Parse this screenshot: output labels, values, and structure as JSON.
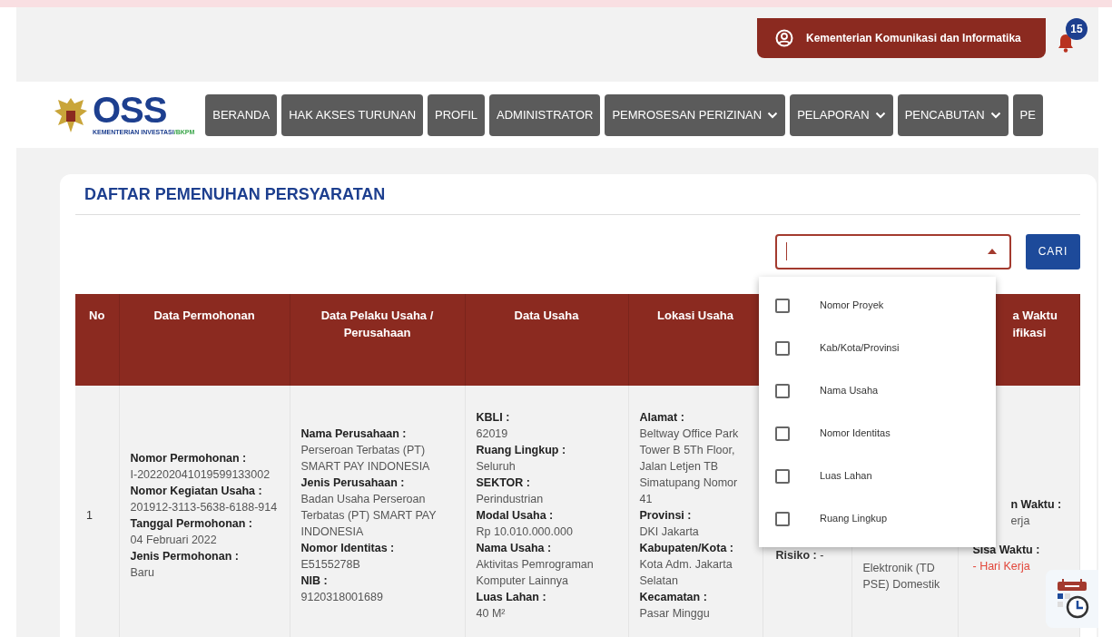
{
  "header": {
    "user_button": "Kementerian Komunikasi dan Informatika",
    "notification_count": "15"
  },
  "logo": {
    "wordmark": "OSS",
    "tagline": "KEMENTERIAN INVESTASI",
    "tagline_suffix": "/BKPM"
  },
  "nav": [
    {
      "label": "BERANDA",
      "dropdown": false
    },
    {
      "label": "HAK AKSES TURUNAN",
      "dropdown": false
    },
    {
      "label": "PROFIL",
      "dropdown": false
    },
    {
      "label": "ADMINISTRATOR",
      "dropdown": false
    },
    {
      "label": "PEMROSESAN PERIZINAN",
      "dropdown": true
    },
    {
      "label": "PELAPORAN",
      "dropdown": true
    },
    {
      "label": "PENCABUTAN",
      "dropdown": true
    },
    {
      "label": "PE",
      "dropdown": false
    }
  ],
  "card": {
    "title": "DAFTAR PEMENUHAN PERSYARATAN"
  },
  "filter": {
    "open": true,
    "options": [
      {
        "label": "Nomor Proyek",
        "checked": false
      },
      {
        "label": "Kab/Kota/Provinsi",
        "checked": false
      },
      {
        "label": "Nama Usaha",
        "checked": false
      },
      {
        "label": "Nomor Identitas",
        "checked": false
      },
      {
        "label": "Luas Lahan",
        "checked": false
      },
      {
        "label": "Ruang Lingkup",
        "checked": false
      }
    ],
    "button": "CARI"
  },
  "table": {
    "columns": [
      "No",
      "Data Permohonan",
      "Data Pelaku Usaha / Perusahaan",
      "Data Usaha",
      "Lokasi Usaha"
    ],
    "column_8_header": [
      "a Waktu",
      "ifikasi"
    ],
    "rows": [
      {
        "no": "1",
        "data_permohonan": [
          {
            "label": "Nomor Permohonan :",
            "value": "I-202202041019599133002"
          },
          {
            "label": "Nomor Kegiatan Usaha :",
            "value": "201912-3113-5638-6188-914"
          },
          {
            "label": "Tanggal Permohonan :",
            "value": "04 Februari 2022"
          },
          {
            "label": "Jenis Permohonan :",
            "value": "Baru"
          }
        ],
        "data_pelaku_usaha": [
          {
            "label": "Nama Perusahaan :",
            "value": "Perseroan Terbatas (PT) SMART PAY INDONESIA"
          },
          {
            "label": "Jenis Perusahaan :",
            "value": "Badan Usaha Perseroan Terbatas (PT) SMART PAY INDONESIA"
          },
          {
            "label": "Nomor Identitas :",
            "value": "E5155278B"
          },
          {
            "label": "NIB :",
            "value": "9120318001689"
          }
        ],
        "data_usaha": [
          {
            "label": "KBLI :",
            "value": "62019"
          },
          {
            "label": "Ruang Lingkup :",
            "value": "Seluruh"
          },
          {
            "label": "SEKTOR :",
            "value": "Perindustrian"
          },
          {
            "label": "Modal Usaha :",
            "value": "Rp 10.010.000.000"
          },
          {
            "label": "Nama Usaha :",
            "value": "Aktivitas Pemrograman Komputer Lainnya"
          },
          {
            "label": "Luas Lahan :",
            "value": "40 M²"
          }
        ],
        "lokasi_usaha": [
          {
            "label": "Alamat :",
            "value": "Beltway Office Park Tower B 5Th Floor, Jalan Letjen TB Simatupang Nomor 41"
          },
          {
            "label": "Provinsi :",
            "value": "DKI Jakarta"
          },
          {
            "label": "Kabupaten/Kota :",
            "value": "Kota Adm. Jakarta Selatan"
          },
          {
            "label": "Kecamatan :",
            "value": "Pasar Minggu"
          }
        ],
        "column_6": "**Risiko :** -",
        "column_7": "Elektronik (TD PSE) Domestik",
        "column_8": [
          {
            "kind": "label",
            "text": "n Waktu :"
          },
          {
            "kind": "value",
            "text": "erja"
          },
          {
            "kind": "label",
            "text": "Sisa Waktu :"
          },
          {
            "kind": "warning",
            "text": "- Hari Kerja"
          }
        ]
      }
    ]
  }
}
